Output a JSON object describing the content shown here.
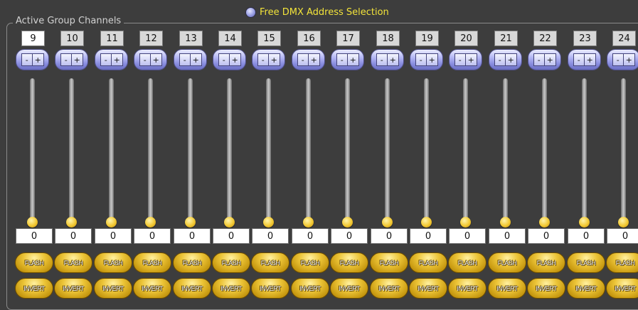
{
  "group_title": "Active Group Channels",
  "dmx_option": {
    "label": "Free DMX Address Selection",
    "selected": false
  },
  "colors": {
    "option_text": "#f2e33a",
    "pm_button": "#9da3e6",
    "knob": "#f2c934",
    "background": "#3d3d3d"
  },
  "plus_label": "+",
  "minus_label": "-",
  "flash_label": "FLASH",
  "invert_label": "INVERT",
  "channels": [
    {
      "number": "9",
      "value": "0",
      "level": 0,
      "selected": true
    },
    {
      "number": "10",
      "value": "0",
      "level": 0
    },
    {
      "number": "11",
      "value": "0",
      "level": 0
    },
    {
      "number": "12",
      "value": "0",
      "level": 0
    },
    {
      "number": "13",
      "value": "0",
      "level": 0
    },
    {
      "number": "14",
      "value": "0",
      "level": 0
    },
    {
      "number": "15",
      "value": "0",
      "level": 0
    },
    {
      "number": "16",
      "value": "0",
      "level": 0
    },
    {
      "number": "17",
      "value": "0",
      "level": 0
    },
    {
      "number": "18",
      "value": "0",
      "level": 0
    },
    {
      "number": "19",
      "value": "0",
      "level": 0
    },
    {
      "number": "20",
      "value": "0",
      "level": 0
    },
    {
      "number": "21",
      "value": "0",
      "level": 0
    },
    {
      "number": "22",
      "value": "0",
      "level": 0
    },
    {
      "number": "23",
      "value": "0",
      "level": 0
    },
    {
      "number": "24",
      "value": "0",
      "level": 0
    }
  ]
}
